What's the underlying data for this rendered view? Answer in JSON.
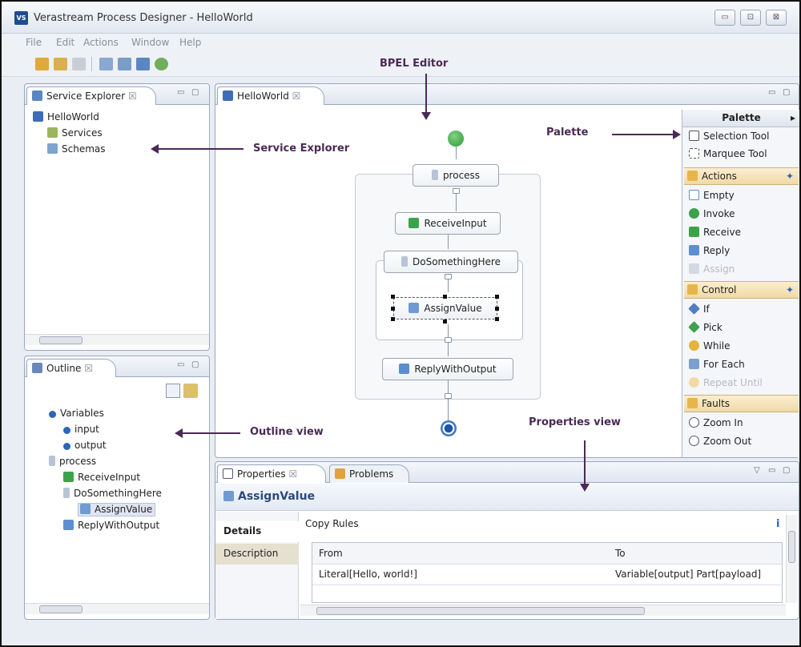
{
  "window": {
    "title": "Verastream Process Designer - HelloWorld",
    "app_icon": "VS",
    "buttons": [
      "▭",
      "⊡",
      "⊠"
    ]
  },
  "menu": [
    "File",
    "Edit",
    "Actions",
    "Window",
    "Help"
  ],
  "annotations": {
    "bpel_editor": "BPEL Editor",
    "palette": "Palette",
    "service_explorer": "Service Explorer",
    "outline_view": "Outline view",
    "properties_view": "Properties view"
  },
  "service_explorer": {
    "tab": "Service Explorer",
    "tab_suffix": "☒",
    "items": [
      "HelloWorld",
      "Services",
      "Schemas"
    ]
  },
  "outline": {
    "tab": "Outline",
    "tab_suffix": "☒",
    "items": [
      "Variables",
      "input",
      "output",
      "process",
      "ReceiveInput",
      "DoSomethingHere",
      "AssignValue",
      "ReplyWithOutput"
    ]
  },
  "editor": {
    "tab": "HelloWorld",
    "tab_suffix": "☒",
    "nodes": {
      "process": "process",
      "receive": "ReceiveInput",
      "do_something": "DoSomethingHere",
      "assign": "AssignValue",
      "reply": "ReplyWithOutput"
    }
  },
  "palette": {
    "title": "Palette",
    "tools": [
      "Selection Tool",
      "Marquee Tool"
    ],
    "actions_header": "Actions",
    "actions": [
      "Empty",
      "Invoke",
      "Receive",
      "Reply",
      "Assign"
    ],
    "control_header": "Control",
    "control": [
      "If",
      "Pick",
      "While",
      "For Each",
      "Repeat Until"
    ],
    "faults_header": "Faults",
    "zoom": [
      "Zoom In",
      "Zoom Out"
    ]
  },
  "properties": {
    "tabs": [
      "Properties",
      "Problems"
    ],
    "tab_suffix": "☒",
    "title": "AssignValue",
    "side_tabs": [
      "Details",
      "Description"
    ],
    "section": "Copy Rules",
    "columns": [
      "From",
      "To"
    ],
    "rows": [
      [
        "Literal[Hello, world!]",
        "Variable[output] Part[payload]"
      ]
    ],
    "info_icon": "i"
  },
  "colors": {
    "accent": "#4a2a55",
    "green": "#3aa34a",
    "blue": "#2b66b8",
    "panel_border": "#9aa9bd"
  }
}
